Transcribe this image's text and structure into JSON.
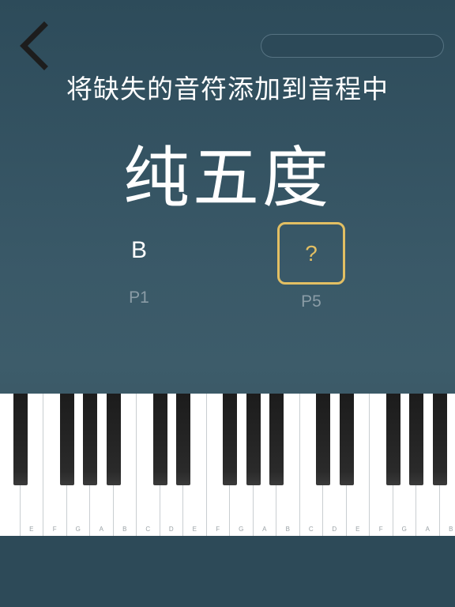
{
  "header": {
    "back_icon": "chevron-left-icon"
  },
  "question": {
    "instruction": "将缺失的音符添加到音程中",
    "interval_name": "纯五度",
    "known_note": "B",
    "known_label": "P1",
    "answer_placeholder": "?",
    "answer_label": "P5"
  },
  "keyboard": {
    "white_keys": [
      "",
      "E",
      "F",
      "G",
      "A",
      "B",
      "C",
      "D",
      "E",
      "F",
      "G",
      "A",
      "B",
      "C",
      "D",
      "E",
      "F",
      "G",
      "A",
      "B"
    ],
    "black_key_count": 14
  },
  "colors": {
    "accent": "#e2bf63",
    "background": "#3a5968",
    "muted_label": "#8a9ca6"
  }
}
